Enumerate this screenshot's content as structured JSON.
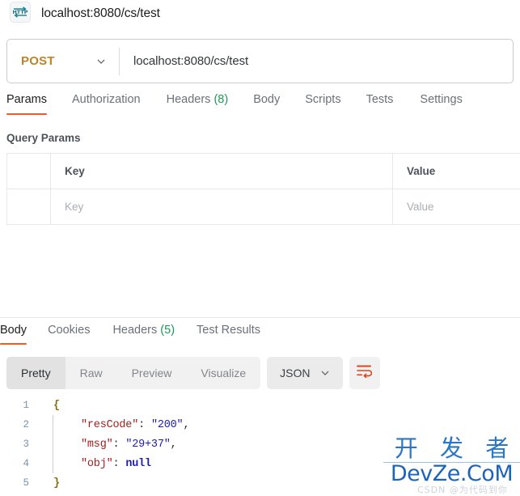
{
  "header": {
    "icon": "http-protocol-icon",
    "icon_text": "HTTP",
    "title": "localhost:8080/cs/test"
  },
  "url_bar": {
    "method": "POST",
    "method_chevron": "chevron-down-icon",
    "url": "localhost:8080/cs/test"
  },
  "request_tabs": [
    {
      "label": "Params",
      "count": "",
      "active": true
    },
    {
      "label": "Authorization",
      "count": "",
      "active": false
    },
    {
      "label": "Headers",
      "count": "(8)",
      "active": false
    },
    {
      "label": "Body",
      "count": "",
      "active": false
    },
    {
      "label": "Scripts",
      "count": "",
      "active": false
    },
    {
      "label": "Tests",
      "count": "",
      "active": false
    },
    {
      "label": "Settings",
      "count": "",
      "active": false
    }
  ],
  "query_params": {
    "section_title": "Query Params",
    "columns": [
      "",
      "Key",
      "Value"
    ],
    "rows": [
      {
        "key_placeholder": "Key",
        "value_placeholder": "Value"
      }
    ]
  },
  "response_tabs": [
    {
      "label": "Body",
      "count": "",
      "active": true
    },
    {
      "label": "Cookies",
      "count": "",
      "active": false
    },
    {
      "label": "Headers",
      "count": "(5)",
      "active": false
    },
    {
      "label": "Test Results",
      "count": "",
      "active": false
    }
  ],
  "format_toolbar": {
    "views": [
      {
        "label": "Pretty",
        "active": true
      },
      {
        "label": "Raw",
        "active": false
      },
      {
        "label": "Preview",
        "active": false
      },
      {
        "label": "Visualize",
        "active": false
      }
    ],
    "language": "JSON",
    "language_chevron": "chevron-down-icon",
    "wrap_button": "word-wrap-icon"
  },
  "response_body": {
    "lines": [
      {
        "num": "1",
        "indent": false,
        "segments": [
          {
            "cls": "brace",
            "t": "{"
          }
        ]
      },
      {
        "num": "2",
        "indent": true,
        "segments": [
          {
            "cls": "k",
            "t": "\"resCode\""
          },
          {
            "cls": "punc",
            "t": ": "
          },
          {
            "cls": "v",
            "t": "\"200\""
          },
          {
            "cls": "punc",
            "t": ","
          }
        ]
      },
      {
        "num": "3",
        "indent": true,
        "segments": [
          {
            "cls": "k",
            "t": "\"msg\""
          },
          {
            "cls": "punc",
            "t": ": "
          },
          {
            "cls": "v",
            "t": "\"29+37\""
          },
          {
            "cls": "punc",
            "t": ","
          }
        ]
      },
      {
        "num": "4",
        "indent": true,
        "segments": [
          {
            "cls": "k",
            "t": "\"obj\""
          },
          {
            "cls": "punc",
            "t": ": "
          },
          {
            "cls": "nul",
            "t": "null"
          }
        ]
      },
      {
        "num": "5",
        "indent": false,
        "segments": [
          {
            "cls": "brace",
            "t": "}"
          }
        ]
      }
    ]
  },
  "watermark": {
    "chinese": "开 发 者",
    "latin": "DevZe.CoM",
    "faint": "CSDN @为代码到你"
  },
  "colors": {
    "accent_orange": "#ef5b25",
    "method_amber": "#c08327",
    "count_green": "#1a9b55",
    "json_key": "#a11f1f",
    "json_value": "#1d1da8",
    "watermark_blue": "#1e63ba"
  }
}
